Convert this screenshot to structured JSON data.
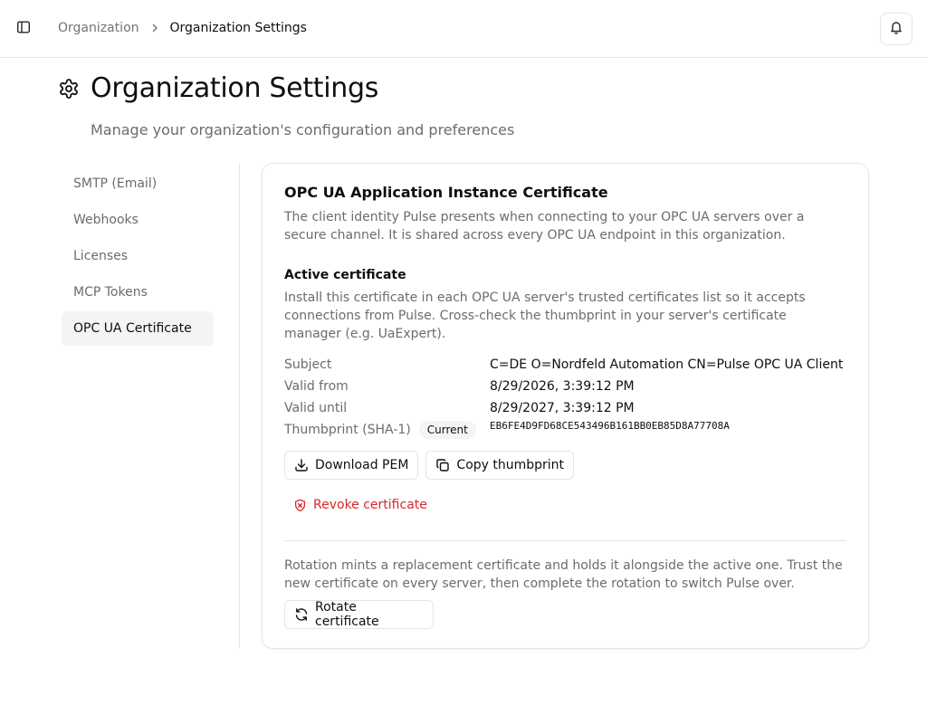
{
  "header": {
    "breadcrumb": [
      "Organization",
      "Organization Settings"
    ]
  },
  "page": {
    "title": "Organization Settings",
    "subtitle": "Manage your organization's configuration and preferences"
  },
  "nav": {
    "items": [
      {
        "label": "SMTP (Email)",
        "active": false
      },
      {
        "label": "Webhooks",
        "active": false
      },
      {
        "label": "Licenses",
        "active": false
      },
      {
        "label": "MCP Tokens",
        "active": false
      },
      {
        "label": "OPC UA Certificate",
        "active": true
      }
    ]
  },
  "card": {
    "title": "OPC UA Application Instance Certificate",
    "description": "The client identity Pulse presents when connecting to your OPC UA servers over a secure channel. It is shared across every OPC UA endpoint in this organization.",
    "active": {
      "title": "Active certificate",
      "description": "Install this certificate in each OPC UA server's trusted certificates list so it accepts connections from Pulse. Cross-check the thumbprint in your server's certificate manager (e.g. UaExpert).",
      "subject_label": "Subject",
      "subject": "C=DE O=Nordfeld Automation CN=Pulse OPC UA Client",
      "valid_from_label": "Valid from",
      "valid_from": "8/29/2026, 3:39:12 PM",
      "valid_until_label": "Valid until",
      "valid_until": "8/29/2027, 3:39:12 PM",
      "thumbprint_label": "Thumbprint (SHA-1)",
      "badge": "Current",
      "thumbprint": "EB6FE4D9FD68CE543496B161BB0EB85D8A77708A"
    },
    "buttons": {
      "download": "Download PEM",
      "copy": "Copy thumbprint",
      "revoke": "Revoke certificate"
    },
    "rotation": {
      "description": "Rotation mints a replacement certificate and holds it alongside the active one. Trust the new certificate on every server, then complete the rotation to switch Pulse over.",
      "button": "Rotate certificate"
    }
  },
  "colors": {
    "danger": "#dc2626",
    "muted": "#6b6b72",
    "active_nav_bg": "#f4f4f5"
  },
  "icons": [
    "sidebar-toggle-icon",
    "chevron-right-icon",
    "bell-icon",
    "gear-icon",
    "download-icon",
    "copy-icon",
    "shield-x-icon",
    "refresh-icon"
  ]
}
